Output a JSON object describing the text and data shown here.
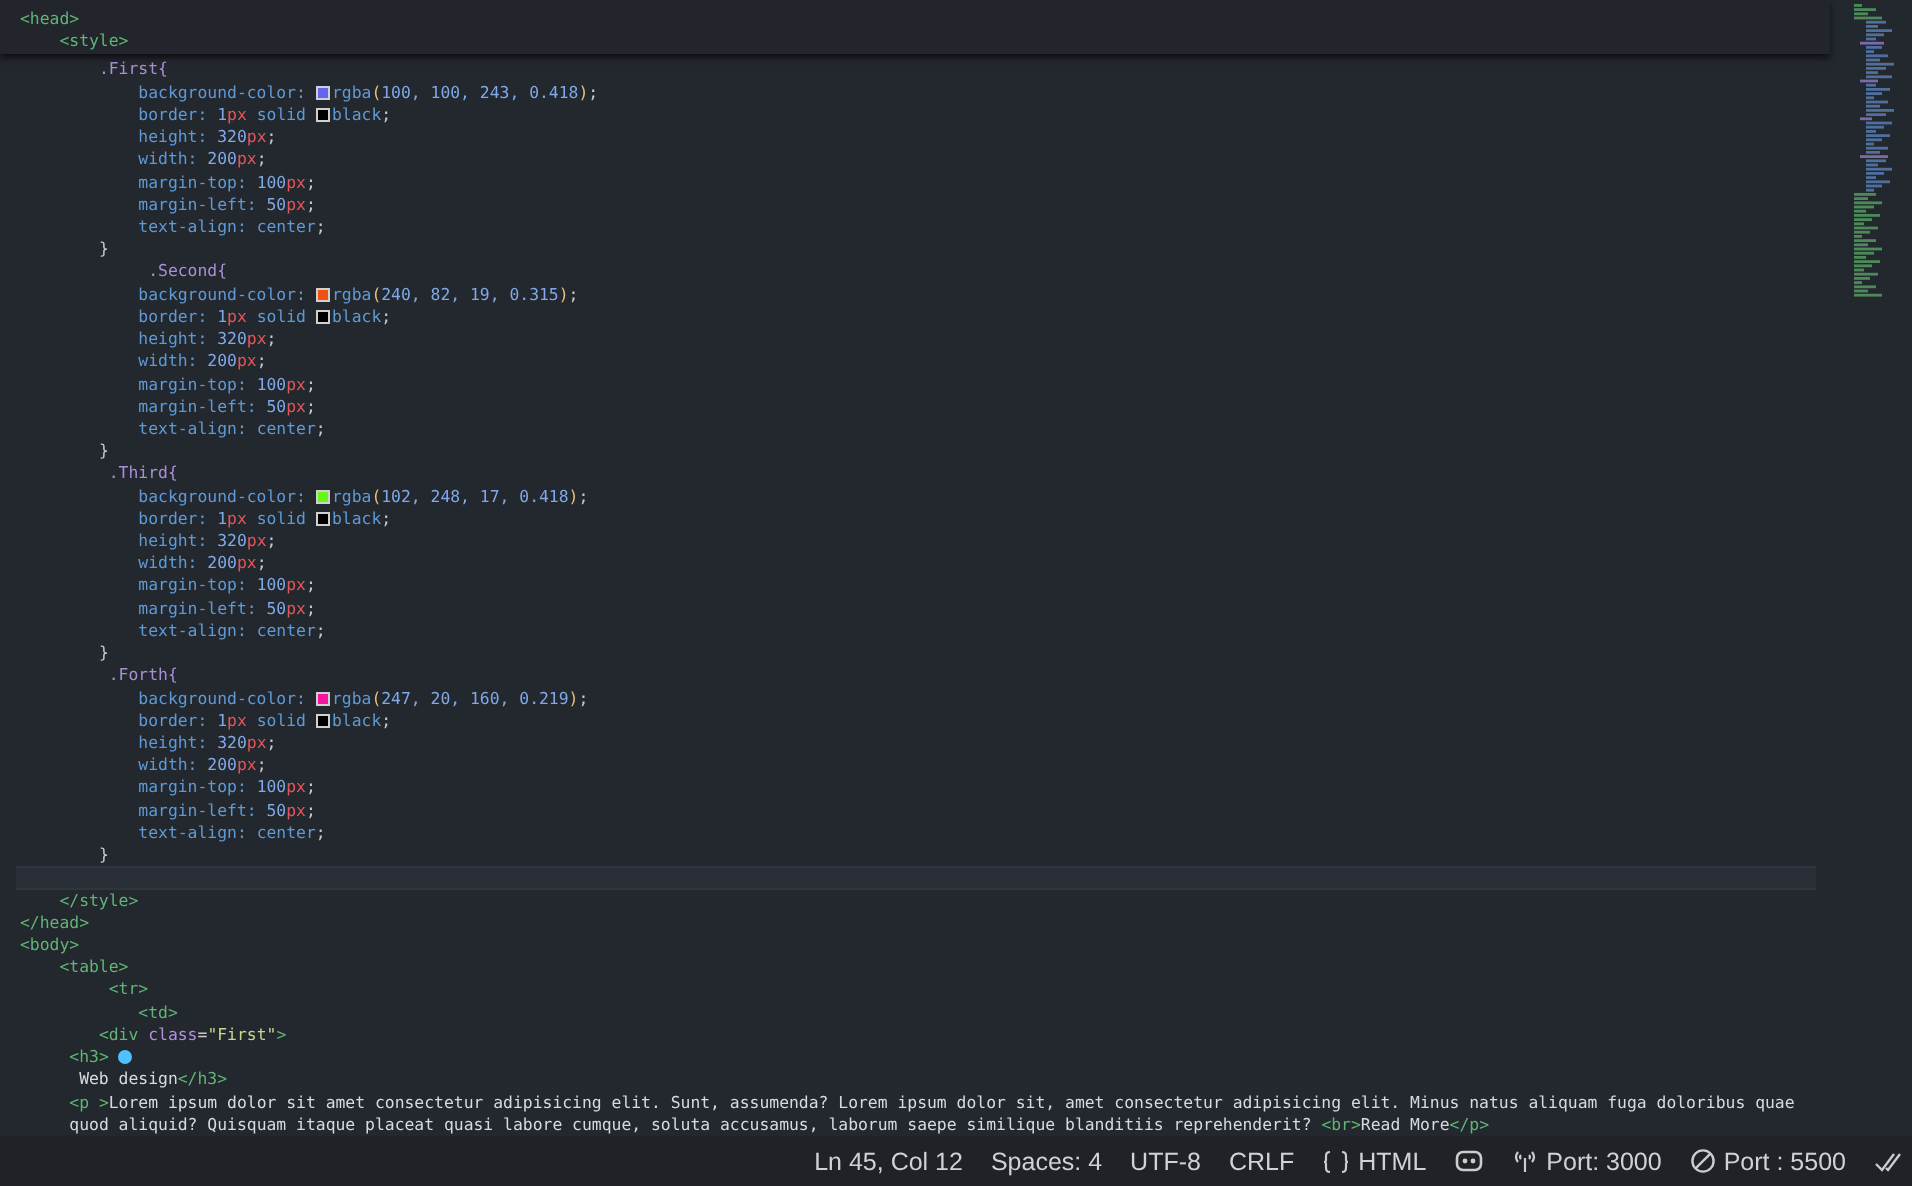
{
  "editor": {
    "sticky_lines": [
      {
        "tokens": [
          {
            "kind": "tag",
            "text": "<head>"
          }
        ]
      },
      {
        "tokens": [
          {
            "kind": "tag",
            "text": "    <style>"
          }
        ]
      }
    ],
    "lines": [
      {
        "current": false,
        "tokens": [
          {
            "kind": "sel",
            "text": "        .First{"
          }
        ]
      },
      {
        "current": false,
        "tokens": [
          {
            "kind": "prop",
            "text": "            background-color:"
          },
          {
            "kind": "swatch",
            "color": "#6464f3"
          },
          {
            "kind": "val",
            "text": "rgba"
          },
          {
            "kind": "paren",
            "text": "("
          },
          {
            "kind": "num",
            "text": "100, 100, 243, 0.418"
          },
          {
            "kind": "paren",
            "text": ")"
          },
          {
            "kind": "punct",
            "text": ";"
          }
        ]
      },
      {
        "current": false,
        "tokens": [
          {
            "kind": "prop",
            "text": "            border:"
          },
          {
            "kind": "num",
            "text": " 1"
          },
          {
            "kind": "unit",
            "text": "px"
          },
          {
            "kind": "val",
            "text": " solid"
          },
          {
            "kind": "swatch",
            "color": "#000000"
          },
          {
            "kind": "val",
            "text": "black"
          },
          {
            "kind": "punct",
            "text": ";"
          }
        ]
      },
      {
        "current": false,
        "tokens": [
          {
            "kind": "prop",
            "text": "            height:"
          },
          {
            "kind": "num",
            "text": " 320"
          },
          {
            "kind": "unit",
            "text": "px"
          },
          {
            "kind": "punct",
            "text": ";"
          }
        ]
      },
      {
        "current": false,
        "tokens": [
          {
            "kind": "prop",
            "text": "            width:"
          },
          {
            "kind": "num",
            "text": " 200"
          },
          {
            "kind": "unit",
            "text": "px"
          },
          {
            "kind": "punct",
            "text": ";"
          }
        ]
      },
      {
        "current": false,
        "tokens": [
          {
            "kind": "prop",
            "text": "            margin-top:"
          },
          {
            "kind": "num",
            "text": " 100"
          },
          {
            "kind": "unit",
            "text": "px"
          },
          {
            "kind": "punct",
            "text": ";"
          }
        ]
      },
      {
        "current": false,
        "tokens": [
          {
            "kind": "prop",
            "text": "            margin-left:"
          },
          {
            "kind": "num",
            "text": " 50"
          },
          {
            "kind": "unit",
            "text": "px"
          },
          {
            "kind": "punct",
            "text": ";"
          }
        ]
      },
      {
        "current": false,
        "tokens": [
          {
            "kind": "prop",
            "text": "            text-align:"
          },
          {
            "kind": "val",
            "text": " center"
          },
          {
            "kind": "punct",
            "text": ";"
          }
        ]
      },
      {
        "current": false,
        "tokens": [
          {
            "kind": "punct",
            "text": "        }"
          }
        ]
      },
      {
        "current": false,
        "tokens": [
          {
            "kind": "sel",
            "text": "             .Second{"
          }
        ]
      },
      {
        "current": false,
        "tokens": [
          {
            "kind": "prop",
            "text": "            background-color:"
          },
          {
            "kind": "swatch",
            "color": "#f05213"
          },
          {
            "kind": "val",
            "text": "rgba"
          },
          {
            "kind": "paren",
            "text": "("
          },
          {
            "kind": "num",
            "text": "240, 82, 19, 0.315"
          },
          {
            "kind": "paren",
            "text": ")"
          },
          {
            "kind": "punct",
            "text": ";"
          }
        ]
      },
      {
        "current": false,
        "tokens": [
          {
            "kind": "prop",
            "text": "            border:"
          },
          {
            "kind": "num",
            "text": " 1"
          },
          {
            "kind": "unit",
            "text": "px"
          },
          {
            "kind": "val",
            "text": " solid"
          },
          {
            "kind": "swatch",
            "color": "#000000"
          },
          {
            "kind": "val",
            "text": "black"
          },
          {
            "kind": "punct",
            "text": ";"
          }
        ]
      },
      {
        "current": false,
        "tokens": [
          {
            "kind": "prop",
            "text": "            height:"
          },
          {
            "kind": "num",
            "text": " 320"
          },
          {
            "kind": "unit",
            "text": "px"
          },
          {
            "kind": "punct",
            "text": ";"
          }
        ]
      },
      {
        "current": false,
        "tokens": [
          {
            "kind": "prop",
            "text": "            width:"
          },
          {
            "kind": "num",
            "text": " 200"
          },
          {
            "kind": "unit",
            "text": "px"
          },
          {
            "kind": "punct",
            "text": ";"
          }
        ]
      },
      {
        "current": false,
        "tokens": [
          {
            "kind": "prop",
            "text": "            margin-top:"
          },
          {
            "kind": "num",
            "text": " 100"
          },
          {
            "kind": "unit",
            "text": "px"
          },
          {
            "kind": "punct",
            "text": ";"
          }
        ]
      },
      {
        "current": false,
        "tokens": [
          {
            "kind": "prop",
            "text": "            margin-left:"
          },
          {
            "kind": "num",
            "text": " 50"
          },
          {
            "kind": "unit",
            "text": "px"
          },
          {
            "kind": "punct",
            "text": ";"
          }
        ]
      },
      {
        "current": false,
        "tokens": [
          {
            "kind": "prop",
            "text": "            text-align:"
          },
          {
            "kind": "val",
            "text": " center"
          },
          {
            "kind": "punct",
            "text": ";"
          }
        ]
      },
      {
        "current": false,
        "tokens": [
          {
            "kind": "punct",
            "text": "        }"
          }
        ]
      },
      {
        "current": false,
        "tokens": [
          {
            "kind": "sel",
            "text": "         .Third{"
          }
        ]
      },
      {
        "current": false,
        "tokens": [
          {
            "kind": "prop",
            "text": "            background-color:"
          },
          {
            "kind": "swatch",
            "color": "#66f811"
          },
          {
            "kind": "val",
            "text": "rgba"
          },
          {
            "kind": "paren",
            "text": "("
          },
          {
            "kind": "num",
            "text": "102, 248, 17, 0.418"
          },
          {
            "kind": "paren",
            "text": ")"
          },
          {
            "kind": "punct",
            "text": ";"
          }
        ]
      },
      {
        "current": false,
        "tokens": [
          {
            "kind": "prop",
            "text": "            border:"
          },
          {
            "kind": "num",
            "text": " 1"
          },
          {
            "kind": "unit",
            "text": "px"
          },
          {
            "kind": "val",
            "text": " solid"
          },
          {
            "kind": "swatch",
            "color": "#000000"
          },
          {
            "kind": "val",
            "text": "black"
          },
          {
            "kind": "punct",
            "text": ";"
          }
        ]
      },
      {
        "current": false,
        "tokens": [
          {
            "kind": "prop",
            "text": "            height:"
          },
          {
            "kind": "num",
            "text": " 320"
          },
          {
            "kind": "unit",
            "text": "px"
          },
          {
            "kind": "punct",
            "text": ";"
          }
        ]
      },
      {
        "current": false,
        "tokens": [
          {
            "kind": "prop",
            "text": "            width:"
          },
          {
            "kind": "num",
            "text": " 200"
          },
          {
            "kind": "unit",
            "text": "px"
          },
          {
            "kind": "punct",
            "text": ";"
          }
        ]
      },
      {
        "current": false,
        "tokens": [
          {
            "kind": "prop",
            "text": "            margin-top:"
          },
          {
            "kind": "num",
            "text": " 100"
          },
          {
            "kind": "unit",
            "text": "px"
          },
          {
            "kind": "punct",
            "text": ";"
          }
        ]
      },
      {
        "current": false,
        "tokens": [
          {
            "kind": "prop",
            "text": "            margin-left:"
          },
          {
            "kind": "num",
            "text": " 50"
          },
          {
            "kind": "unit",
            "text": "px"
          },
          {
            "kind": "punct",
            "text": ";"
          }
        ]
      },
      {
        "current": false,
        "tokens": [
          {
            "kind": "prop",
            "text": "            text-align:"
          },
          {
            "kind": "val",
            "text": " center"
          },
          {
            "kind": "punct",
            "text": ";"
          }
        ]
      },
      {
        "current": false,
        "tokens": [
          {
            "kind": "punct",
            "text": "        }"
          }
        ]
      },
      {
        "current": false,
        "tokens": [
          {
            "kind": "sel",
            "text": "         .Forth{"
          }
        ]
      },
      {
        "current": false,
        "tokens": [
          {
            "kind": "prop",
            "text": "            background-color:"
          },
          {
            "kind": "swatch",
            "color": "#f714a0"
          },
          {
            "kind": "val",
            "text": "rgba"
          },
          {
            "kind": "paren",
            "text": "("
          },
          {
            "kind": "num",
            "text": "247, 20, 160, 0.219"
          },
          {
            "kind": "paren",
            "text": ")"
          },
          {
            "kind": "punct",
            "text": ";"
          }
        ]
      },
      {
        "current": false,
        "tokens": [
          {
            "kind": "prop",
            "text": "            border:"
          },
          {
            "kind": "num",
            "text": " 1"
          },
          {
            "kind": "unit",
            "text": "px"
          },
          {
            "kind": "val",
            "text": " solid"
          },
          {
            "kind": "swatch",
            "color": "#000000"
          },
          {
            "kind": "val",
            "text": "black"
          },
          {
            "kind": "punct",
            "text": ";"
          }
        ]
      },
      {
        "current": false,
        "tokens": [
          {
            "kind": "prop",
            "text": "            height:"
          },
          {
            "kind": "num",
            "text": " 320"
          },
          {
            "kind": "unit",
            "text": "px"
          },
          {
            "kind": "punct",
            "text": ";"
          }
        ]
      },
      {
        "current": false,
        "tokens": [
          {
            "kind": "prop",
            "text": "            width:"
          },
          {
            "kind": "num",
            "text": " 200"
          },
          {
            "kind": "unit",
            "text": "px"
          },
          {
            "kind": "punct",
            "text": ";"
          }
        ]
      },
      {
        "current": false,
        "tokens": [
          {
            "kind": "prop",
            "text": "            margin-top:"
          },
          {
            "kind": "num",
            "text": " 100"
          },
          {
            "kind": "unit",
            "text": "px"
          },
          {
            "kind": "punct",
            "text": ";"
          }
        ]
      },
      {
        "current": false,
        "tokens": [
          {
            "kind": "prop",
            "text": "            margin-left:"
          },
          {
            "kind": "num",
            "text": " 50"
          },
          {
            "kind": "unit",
            "text": "px"
          },
          {
            "kind": "punct",
            "text": ";"
          }
        ]
      },
      {
        "current": false,
        "tokens": [
          {
            "kind": "prop",
            "text": "            text-align:"
          },
          {
            "kind": "val",
            "text": " center"
          },
          {
            "kind": "punct",
            "text": ";"
          }
        ]
      },
      {
        "current": false,
        "tokens": [
          {
            "kind": "punct",
            "text": "        }"
          }
        ]
      },
      {
        "current": true
      },
      {
        "current": false,
        "tokens": [
          {
            "kind": "tag",
            "text": "    </style>"
          }
        ]
      },
      {
        "current": false,
        "tokens": [
          {
            "kind": "tag",
            "text": "</head>"
          }
        ]
      },
      {
        "current": false,
        "tokens": [
          {
            "kind": "tag",
            "text": "<body>"
          }
        ]
      },
      {
        "current": false,
        "tokens": [
          {
            "kind": "tag",
            "text": "    <table>"
          }
        ]
      },
      {
        "current": false,
        "tokens": [
          {
            "kind": "tag",
            "text": "         <tr>"
          }
        ]
      },
      {
        "current": false,
        "tokens": [
          {
            "kind": "tag",
            "text": "            <td>"
          }
        ]
      },
      {
        "current": false,
        "tokens": [
          {
            "kind": "tag",
            "text": "        <div"
          },
          {
            "kind": "attr",
            "text": " class"
          },
          {
            "kind": "punct",
            "text": "="
          },
          {
            "kind": "str",
            "text": "\"First\""
          },
          {
            "kind": "tag",
            "text": ">"
          }
        ]
      },
      {
        "current": false,
        "tokens": [
          {
            "kind": "tag",
            "text": "     <h3>"
          },
          {
            "kind": "dot"
          }
        ]
      },
      {
        "current": false,
        "tokens": [
          {
            "kind": "text",
            "text": "      Web design"
          },
          {
            "kind": "tag",
            "text": "</h3>"
          }
        ]
      },
      {
        "current": false,
        "tokens": [
          {
            "kind": "tag",
            "text": "     <p >"
          },
          {
            "kind": "text",
            "text": "Lorem ipsum dolor sit amet consectetur adipisicing elit. Sunt, assumenda? Lorem ipsum dolor sit, amet consectetur adipisicing elit. Minus natus aliquam fuga doloribus quae"
          }
        ]
      },
      {
        "current": false,
        "tokens": [
          {
            "kind": "text",
            "text": "     quod aliquid? Quisquam itaque placeat quasi labore cumque, soluta accusamus, laborum saepe similique blanditiis reprehenderit? "
          },
          {
            "kind": "tag",
            "text": "<br>"
          },
          {
            "kind": "text",
            "text": "Read More"
          },
          {
            "kind": "tag",
            "text": "</p>"
          }
        ]
      }
    ]
  },
  "status_bar": [
    {
      "kind": "plain",
      "label": "Ln 45, Col 12"
    },
    {
      "kind": "plain",
      "label": "Spaces: 4"
    },
    {
      "kind": "plain",
      "label": "UTF-8"
    },
    {
      "kind": "plain",
      "label": "CRLF"
    },
    {
      "kind": "language",
      "label": "HTML"
    },
    {
      "kind": "copilot"
    },
    {
      "kind": "broadcast",
      "label": "Port: 3000"
    },
    {
      "kind": "blocked",
      "label": "Port : 5500"
    },
    {
      "kind": "checks"
    }
  ]
}
